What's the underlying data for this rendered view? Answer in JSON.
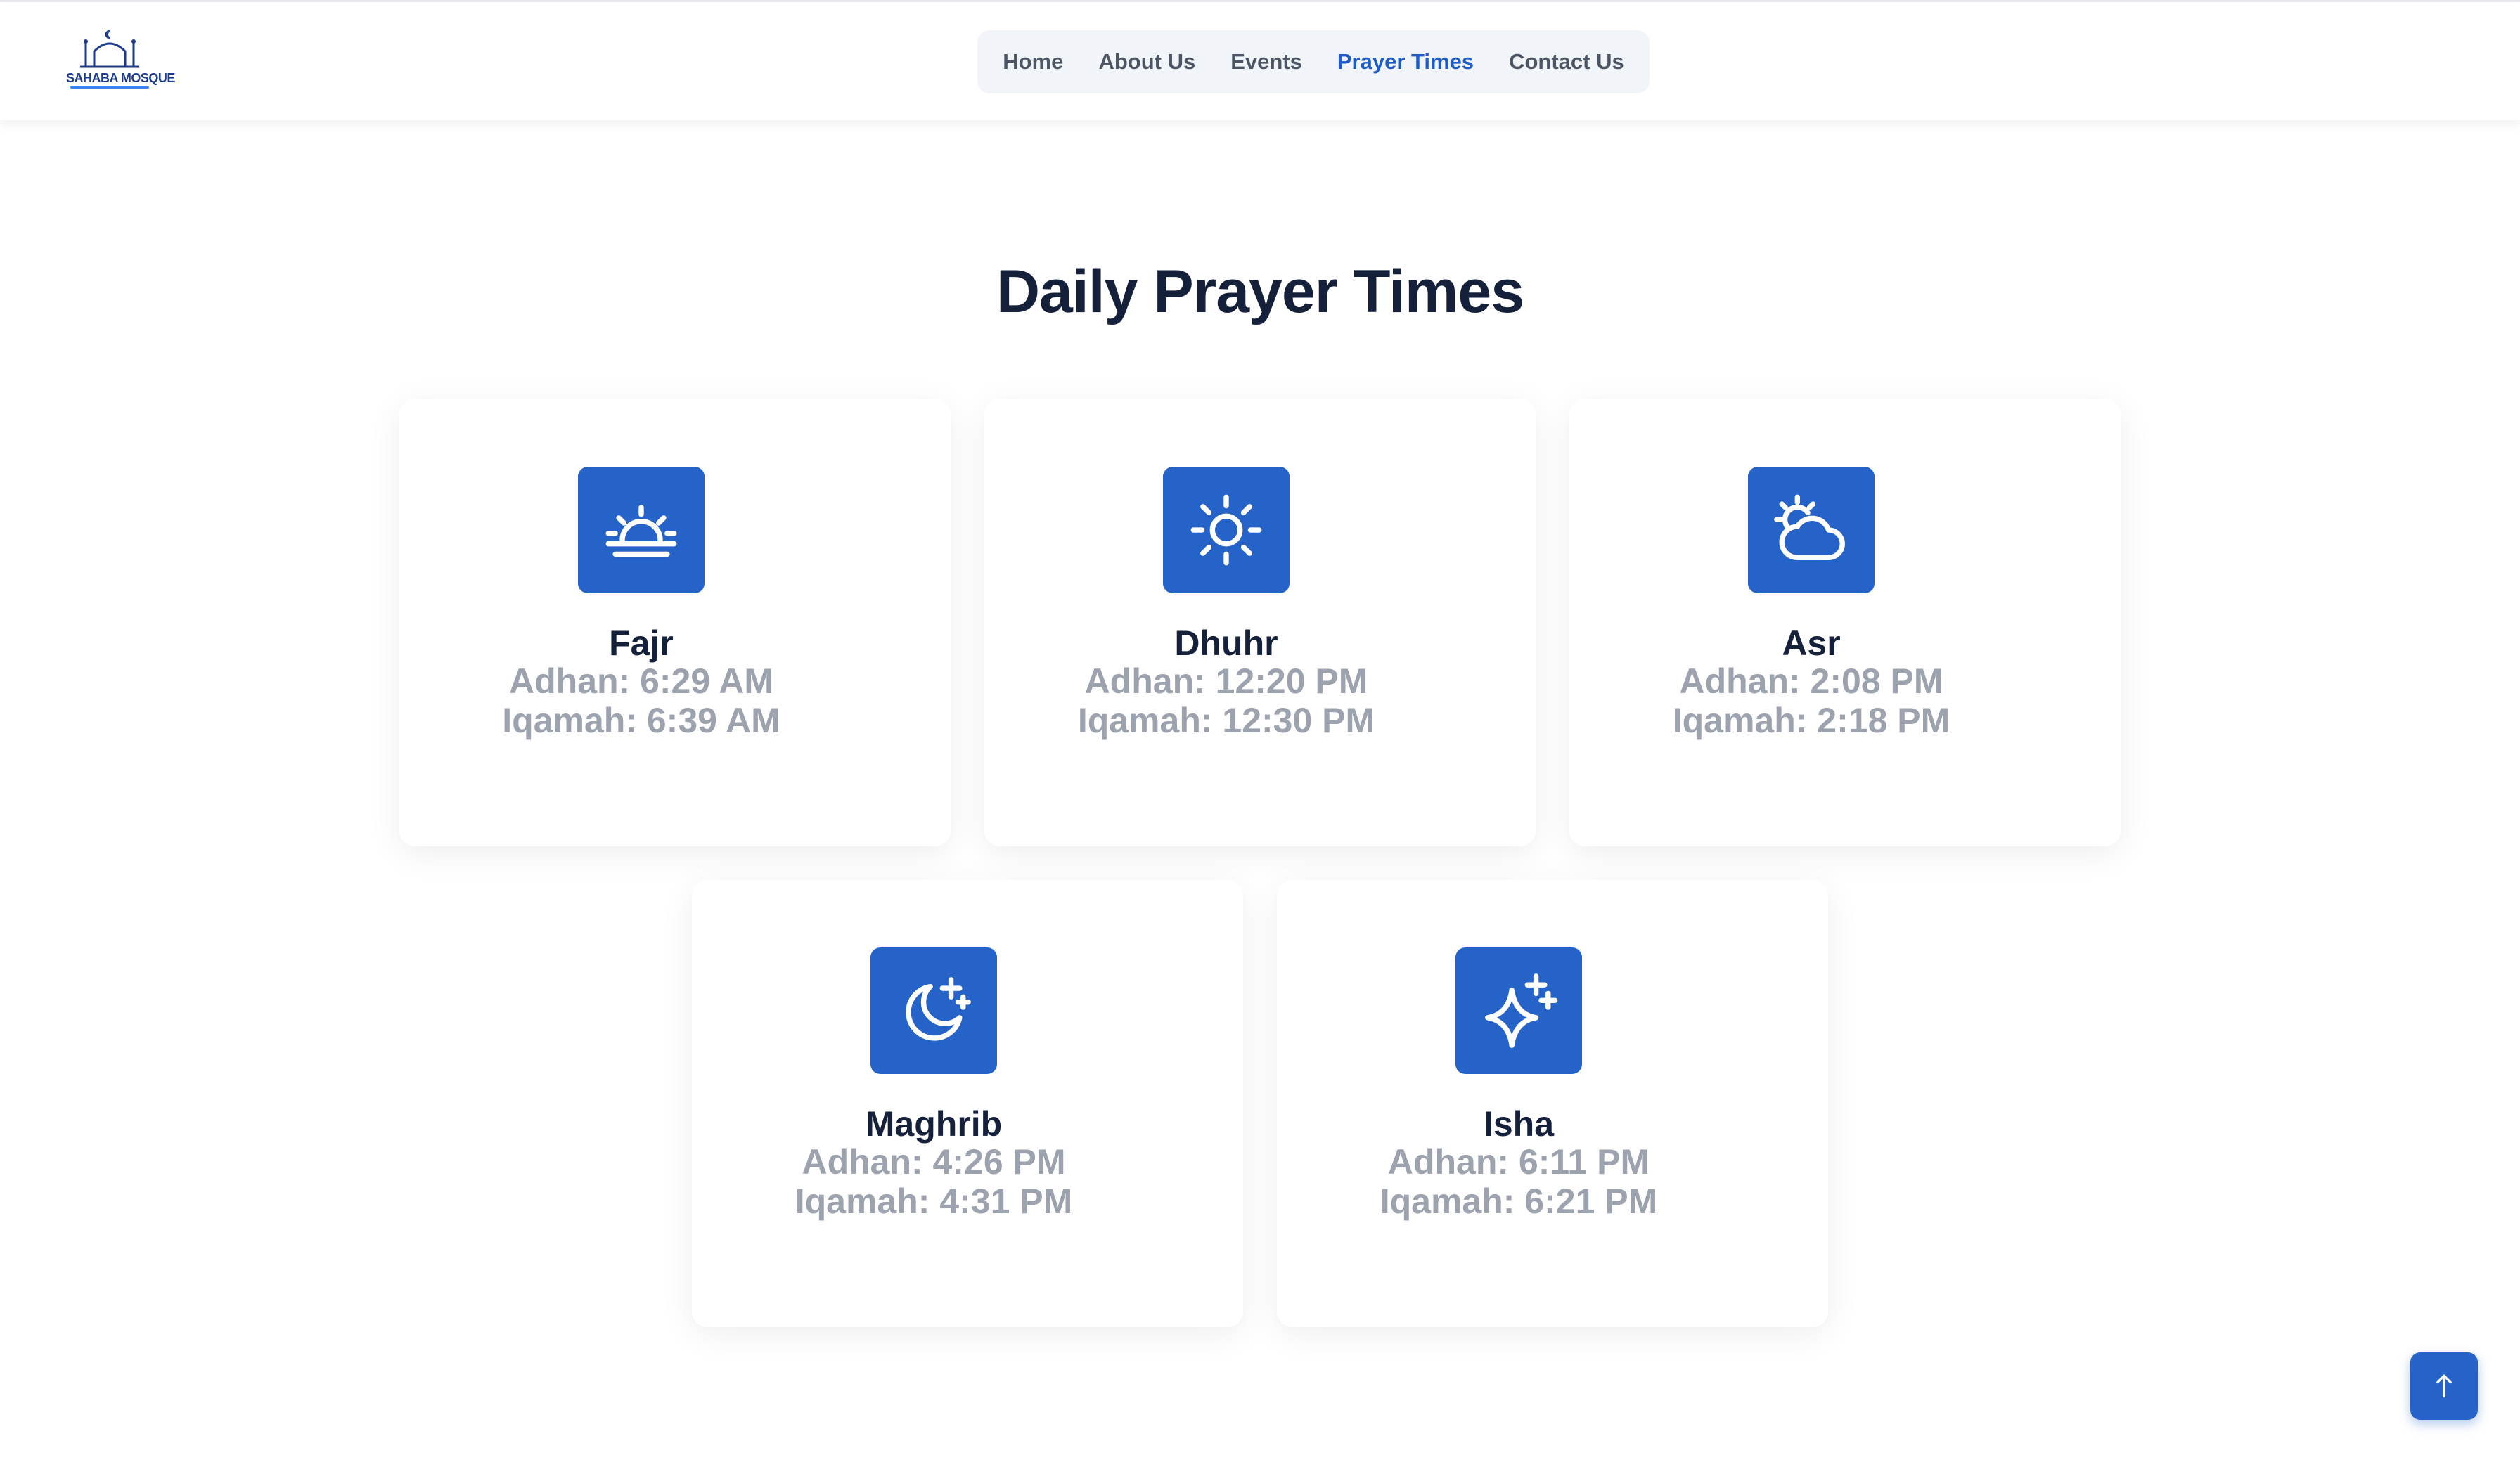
{
  "brand": {
    "logo_text": "SAHABA MOSQUE"
  },
  "nav": {
    "items": [
      {
        "label": "Home",
        "active": false
      },
      {
        "label": "About Us",
        "active": false
      },
      {
        "label": "Events",
        "active": false
      },
      {
        "label": "Prayer Times",
        "active": true
      },
      {
        "label": "Contact Us",
        "active": false
      }
    ]
  },
  "page": {
    "title": "Daily Prayer Times"
  },
  "prayers": [
    {
      "name": "Fajr",
      "adhan": "Adhan: 6:29 AM",
      "iqamah": "Iqamah: 6:39 AM",
      "icon": "sunrise-icon"
    },
    {
      "name": "Dhuhr",
      "adhan": "Adhan: 12:20 PM",
      "iqamah": "Iqamah: 12:30 PM",
      "icon": "sun-icon"
    },
    {
      "name": "Asr",
      "adhan": "Adhan: 2:08 PM",
      "iqamah": "Iqamah: 2:18 PM",
      "icon": "sun-cloud-icon"
    },
    {
      "name": "Maghrib",
      "adhan": "Adhan: 4:26 PM",
      "iqamah": "Iqamah: 4:31 PM",
      "icon": "moon-star-icon"
    },
    {
      "name": "Isha",
      "adhan": "Adhan: 6:11 PM",
      "iqamah": "Iqamah: 6:21 PM",
      "icon": "sparkles-icon"
    }
  ],
  "colors": {
    "accent": "#2563c9",
    "nav_active": "#1e5bc6",
    "heading": "#15213b",
    "muted": "#9ca3af"
  },
  "scroll_to_top": {
    "icon": "arrow-up-icon"
  }
}
